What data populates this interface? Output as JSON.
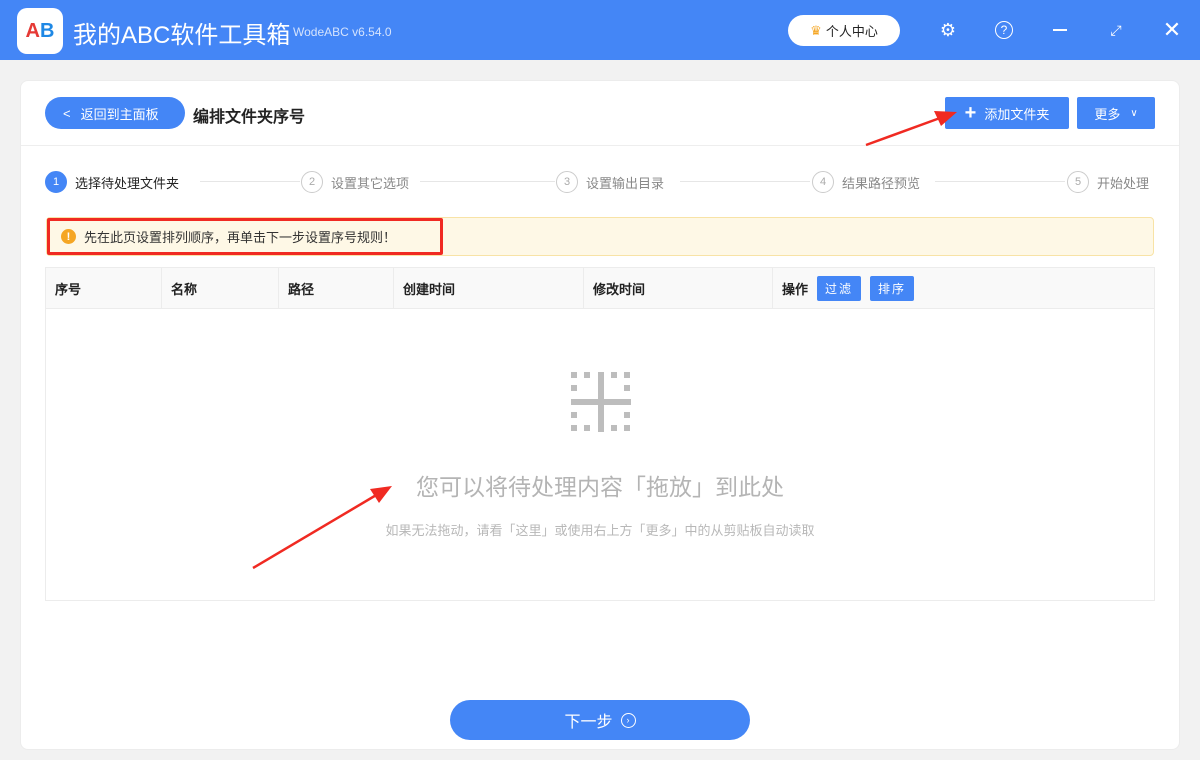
{
  "app": {
    "logo_text": "AB",
    "title": "我的ABC软件工具箱",
    "version": "WodeABC v6.54.0",
    "user_center": "个人中心"
  },
  "header": {
    "back_label": "返回到主面板",
    "page_title": "编排文件夹序号",
    "add_folder_label": "添加文件夹",
    "more_label": "更多"
  },
  "steps": [
    {
      "num": "1",
      "label": "选择待处理文件夹"
    },
    {
      "num": "2",
      "label": "设置其它选项"
    },
    {
      "num": "3",
      "label": "设置输出目录"
    },
    {
      "num": "4",
      "label": "结果路径预览"
    },
    {
      "num": "5",
      "label": "开始处理"
    }
  ],
  "notice": "先在此页设置排列顺序，再单击下一步设置序号规则！",
  "table": {
    "columns": [
      "序号",
      "名称",
      "路径",
      "创建时间",
      "修改时间",
      "操作"
    ],
    "filter_label": "过滤",
    "sort_label": "排序"
  },
  "empty": {
    "title": "您可以将待处理内容「拖放」到此处",
    "subtitle": "如果无法拖动，请看「这里」或使用右上方「更多」中的从剪贴板自动读取"
  },
  "next_label": "下一步",
  "colors": {
    "primary": "#4486f6",
    "highlight": "#f02a22"
  }
}
